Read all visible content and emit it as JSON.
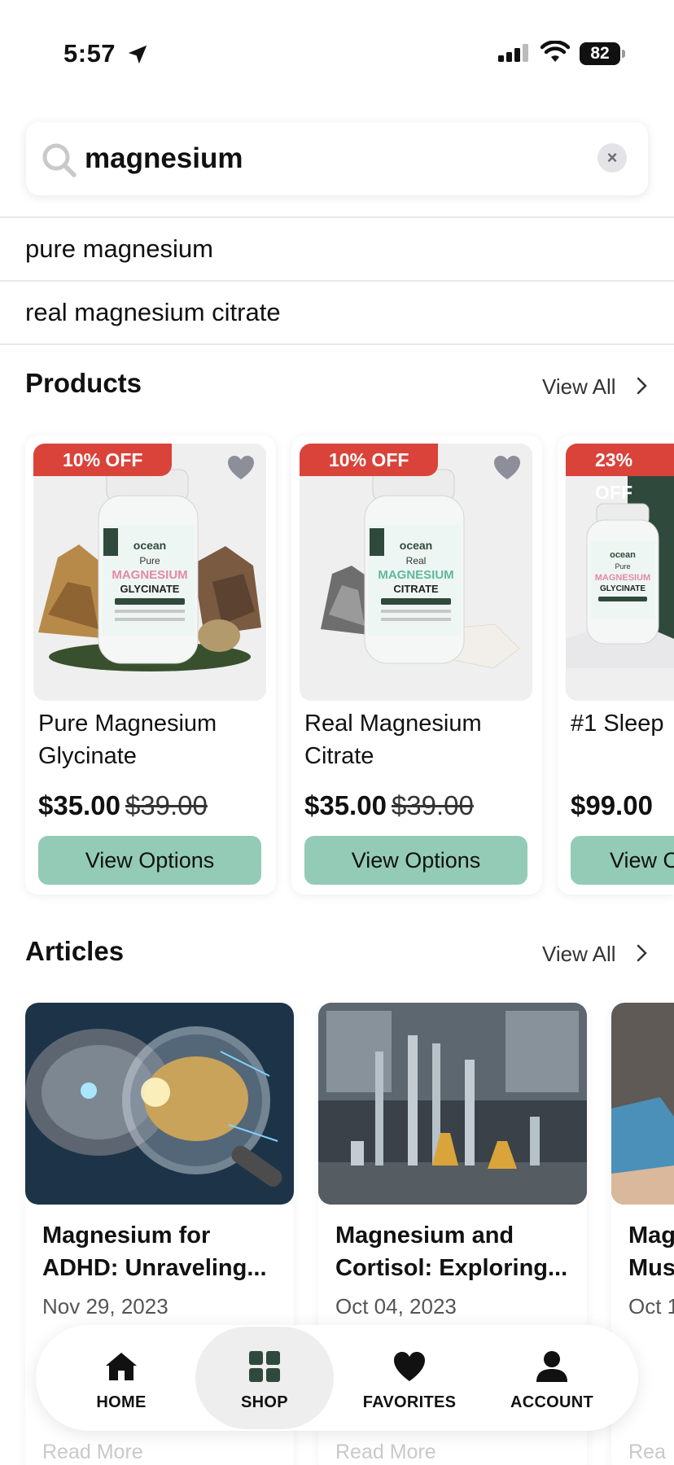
{
  "status_bar": {
    "time": "5:57",
    "battery": "82"
  },
  "search": {
    "value": "magnesium",
    "clear_symbol": "×"
  },
  "suggestions": [
    "pure magnesium",
    "real magnesium citrate"
  ],
  "products_section": {
    "title": "Products",
    "view_all": "View All"
  },
  "products": [
    {
      "discount": "10% OFF",
      "brand": "ocean",
      "bottle_line1": "Pure",
      "bottle_line2": "MAGNESIUM",
      "bottle_line3": "GLYCINATE",
      "name": "Pure Magnesium Glycinate",
      "price": "$35.00",
      "old_price": "$39.00",
      "button": "View Options"
    },
    {
      "discount": "10% OFF",
      "brand": "ocean",
      "bottle_line1": "Real",
      "bottle_line2": "MAGNESIUM",
      "bottle_line3": "CITRATE",
      "name": "Real Magnesium Citrate",
      "price": "$35.00",
      "old_price": "$39.00",
      "button": "View Options"
    },
    {
      "discount": "23% OFF",
      "brand": "ocean",
      "bottle_line1": "Pure",
      "bottle_line2": "MAGNESIUM",
      "bottle_line3": "GLYCINATE",
      "name": "#1 Sleep",
      "price": "$99.00",
      "old_price": "",
      "button": "View Options"
    }
  ],
  "articles_section": {
    "title": "Articles",
    "view_all": "View All"
  },
  "articles": [
    {
      "title": "Magnesium for ADHD: Unraveling...",
      "date": "Nov 29, 2023",
      "read_more": "Read More"
    },
    {
      "title": "Magnesium and Cortisol: Exploring...",
      "date": "Oct 04, 2023",
      "read_more": "Read More"
    },
    {
      "title": "Mag Mus",
      "date": "Oct 1",
      "read_more": "Rea"
    }
  ],
  "tab_bar": {
    "tabs": [
      {
        "label": "HOME",
        "icon": "home-icon"
      },
      {
        "label": "SHOP",
        "icon": "grid-icon"
      },
      {
        "label": "FAVORITES",
        "icon": "heart-icon"
      },
      {
        "label": "ACCOUNT",
        "icon": "person-icon"
      }
    ],
    "active": "SHOP"
  },
  "colors": {
    "accent_green": "#93cbb6",
    "discount_red": "#d9433a",
    "dark_green": "#2f4a3d"
  }
}
